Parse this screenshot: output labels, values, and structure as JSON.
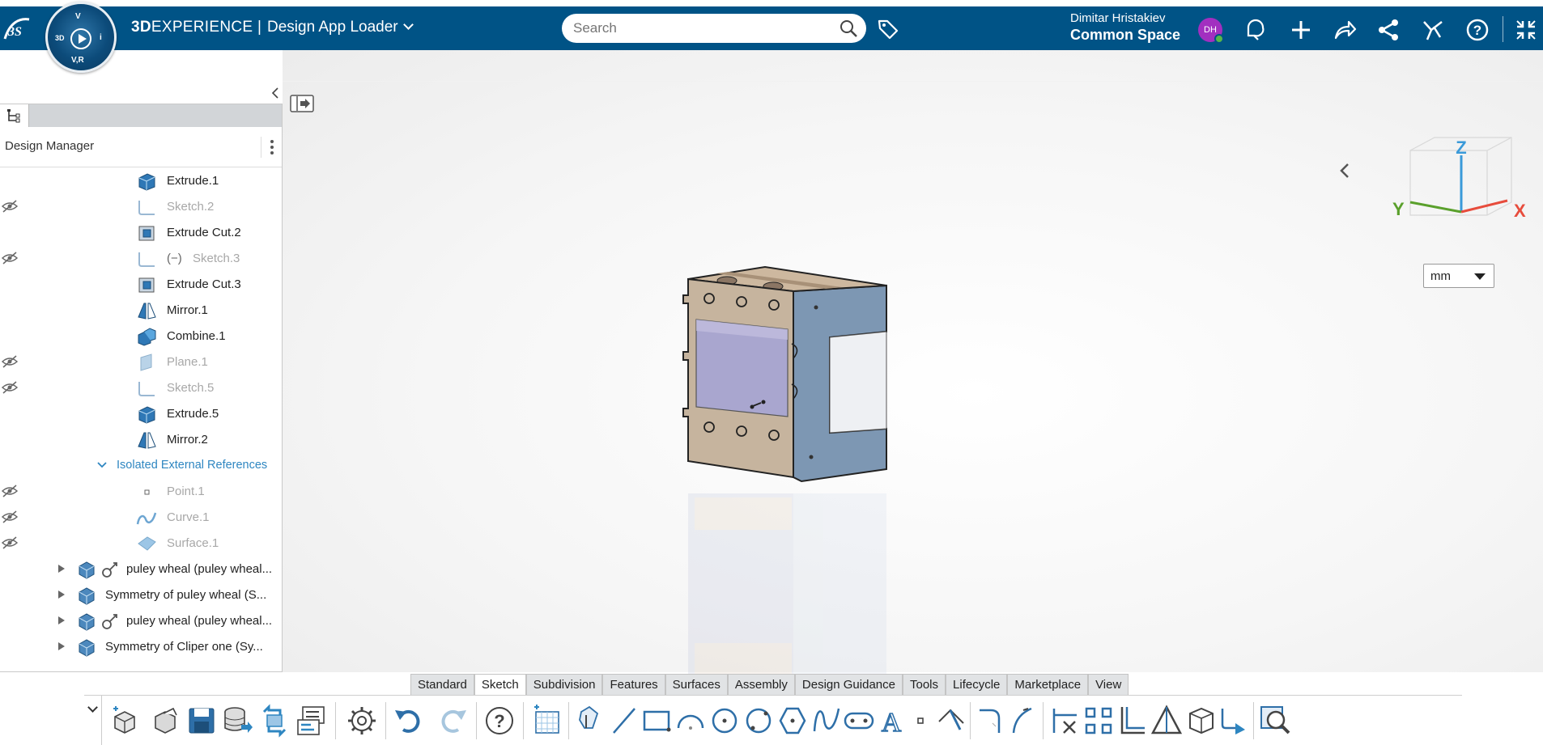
{
  "header": {
    "brand_bold": "3D",
    "brand_rest": "EXPERIENCE |",
    "app_title": "Design App Loader",
    "search_placeholder": "Search",
    "user_name": "Dimitar Hristakiev",
    "space_name": "Common Space",
    "avatar_initials": "DH",
    "compass_labels": {
      "top": "V",
      "left": "3D",
      "right": "i",
      "bottom": "V,R"
    }
  },
  "colors": {
    "topbar": "#005386",
    "accent_blue": "#2e86c1",
    "axis_x": "#e74c3c",
    "axis_y": "#5aa02c",
    "axis_z": "#3a9ad9"
  },
  "design_manager": {
    "title": "Design Manager",
    "rows": [
      {
        "label": "Extrude.1",
        "icon": "extrude-icon",
        "hidden": false,
        "dim": false
      },
      {
        "label": "Sketch.2",
        "icon": "sketch-icon",
        "hidden": true,
        "dim": true
      },
      {
        "label": "Extrude Cut.2",
        "icon": "extrude-cut-icon",
        "hidden": false,
        "dim": false
      },
      {
        "label": "Sketch.3",
        "icon": "sketch-icon",
        "hidden": true,
        "dim": true,
        "prefix": "(−)"
      },
      {
        "label": "Extrude Cut.3",
        "icon": "extrude-cut-icon",
        "hidden": false,
        "dim": false
      },
      {
        "label": "Mirror.1",
        "icon": "mirror-icon",
        "hidden": false,
        "dim": false
      },
      {
        "label": "Combine.1",
        "icon": "combine-icon",
        "hidden": false,
        "dim": false
      },
      {
        "label": "Plane.1",
        "icon": "plane-icon",
        "hidden": true,
        "dim": true
      },
      {
        "label": "Sketch.5",
        "icon": "sketch-icon",
        "hidden": true,
        "dim": true
      },
      {
        "label": "Extrude.5",
        "icon": "extrude-icon",
        "hidden": false,
        "dim": false
      },
      {
        "label": "Mirror.2",
        "icon": "mirror-icon",
        "hidden": false,
        "dim": false
      },
      {
        "label": "Isolated External References",
        "icon": "chevron-down-icon",
        "group": true
      },
      {
        "label": "Point.1",
        "icon": "point-icon",
        "hidden": true,
        "dim": true
      },
      {
        "label": "Curve.1",
        "icon": "curve-icon",
        "hidden": true,
        "dim": true
      },
      {
        "label": "Surface.1",
        "icon": "surface-icon",
        "hidden": true,
        "dim": true
      },
      {
        "label": "puley wheal (puley wheal...",
        "icon": "part-icon",
        "link": true,
        "expandable": true
      },
      {
        "label": "Symmetry of puley wheal (S...",
        "icon": "part-icon",
        "link": false,
        "expandable": true
      },
      {
        "label": "puley wheal (puley wheal...",
        "icon": "part-icon",
        "link": true,
        "expandable": true
      },
      {
        "label": "Symmetry of Cliper one (Sy...",
        "icon": "part-icon",
        "link": false,
        "expandable": true
      }
    ]
  },
  "viewport": {
    "unit": "mm",
    "axes": {
      "x": "X",
      "y": "Y",
      "z": "Z"
    }
  },
  "action_tabs": [
    "Standard",
    "Sketch",
    "Subdivision",
    "Features",
    "Surfaces",
    "Assembly",
    "Design Guidance",
    "Tools",
    "Lifecycle",
    "Marketplace",
    "View"
  ],
  "active_tab": "Sketch",
  "tools": [
    "new-part-icon",
    "open-icon",
    "save-icon",
    "save-database-icon",
    "refresh-icon",
    "properties-icon",
    "settings-icon",
    "undo-icon",
    "redo-icon",
    "help-icon",
    "sketch-grid-icon",
    "select-icon",
    "line-icon",
    "rectangle-icon",
    "arc-icon",
    "circle-icon",
    "circle-3pt-icon",
    "polygon-icon",
    "spline-icon",
    "slot-icon",
    "text-icon",
    "point-tool-icon",
    "axis-icon",
    "fillet-icon",
    "chamfer-icon",
    "trim-icon",
    "mirror-sketch-icon",
    "offset-icon",
    "constraint-icon",
    "cube-view-icon",
    "exit-sketch-icon",
    "sketch-analysis-icon"
  ]
}
